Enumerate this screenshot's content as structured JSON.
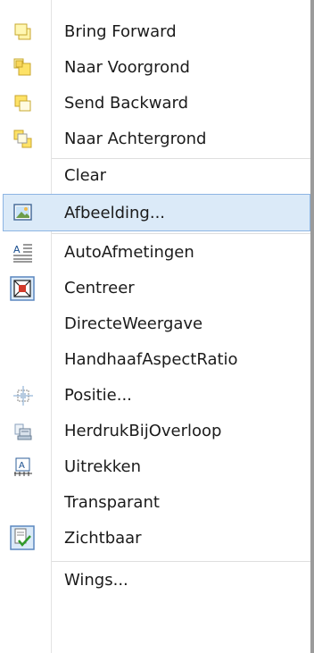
{
  "menu": {
    "items": [
      {
        "label": "Bring Forward",
        "icon": "bring-forward-icon"
      },
      {
        "label": "Naar Voorgrond",
        "icon": "bring-to-front-icon"
      },
      {
        "label": "Send Backward",
        "icon": "send-backward-icon"
      },
      {
        "label": "Naar Achtergrond",
        "icon": "send-to-back-icon"
      },
      {
        "label": "Clear",
        "icon": ""
      },
      {
        "label": "Afbeelding...",
        "icon": "picture-icon"
      },
      {
        "label": "AutoAfmetingen",
        "icon": "auto-size-icon"
      },
      {
        "label": "Centreer",
        "icon": "center-icon"
      },
      {
        "label": "DirecteWeergave",
        "icon": ""
      },
      {
        "label": "HandhaafAspectRatio",
        "icon": ""
      },
      {
        "label": "Positie...",
        "icon": "position-icon"
      },
      {
        "label": "HerdrukBijOverloop",
        "icon": "reprint-overflow-icon"
      },
      {
        "label": "Uitrekken",
        "icon": "stretch-icon"
      },
      {
        "label": "Transparant",
        "icon": ""
      },
      {
        "label": "Zichtbaar",
        "icon": "visible-check-icon"
      },
      {
        "label": "Wings...",
        "icon": ""
      }
    ],
    "highlighted_label": "Afbeelding..."
  }
}
